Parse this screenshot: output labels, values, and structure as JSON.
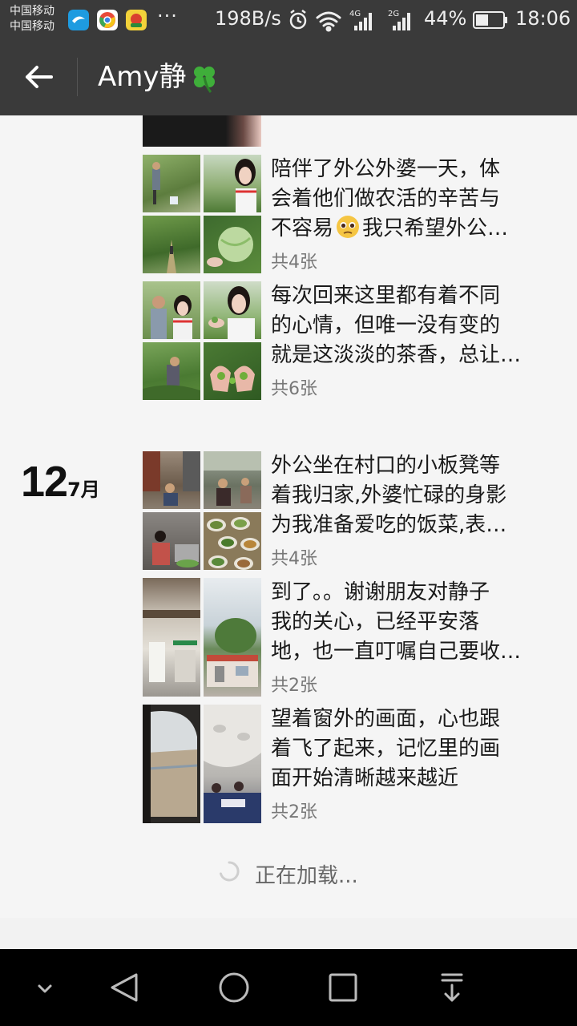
{
  "status_bar": {
    "carrier_1": "中国移动",
    "carrier_2": "中国移动",
    "dots": "···",
    "speed": "198B/s",
    "net_4g": "4G",
    "net_2g": "2G",
    "battery": "44%",
    "time": "18:06"
  },
  "header": {
    "title": "Amy静"
  },
  "date_group": {
    "day": "12",
    "month": "7月"
  },
  "posts": [
    {
      "line1": "陪伴了外公外婆一天，体",
      "line2": "会着他们做农活的辛苦与",
      "line3": "不容易",
      "line3b": "我只希望外公…",
      "count": "共4张"
    },
    {
      "line1": "每次回来这里都有着不同",
      "line2": "的心情，但唯一没有变的",
      "line3": "就是这淡淡的茶香，总让…",
      "count": "共6张"
    },
    {
      "line1": "外公坐在村口的小板凳等",
      "line2": "着我归家,外婆忙碌的身影",
      "line3": "为我准备爱吃的饭菜,表…",
      "count": "共4张"
    },
    {
      "line1": "到了。。谢谢朋友对静子",
      "line2": "我的关心，已经平安落",
      "line3": "地，也一直叮嘱自己要收…",
      "count": "共2张"
    },
    {
      "line1": "望着窗外的画面，心也跟",
      "line2": "着飞了起来，记忆里的画",
      "line3": "面开始清晰越来越近",
      "count": "共2张"
    }
  ],
  "loading": {
    "text": "正在加载..."
  },
  "colors": {
    "status_bg": "#3a3a3a",
    "content_bg": "#f5f5f5",
    "nav_bg": "#000000"
  }
}
